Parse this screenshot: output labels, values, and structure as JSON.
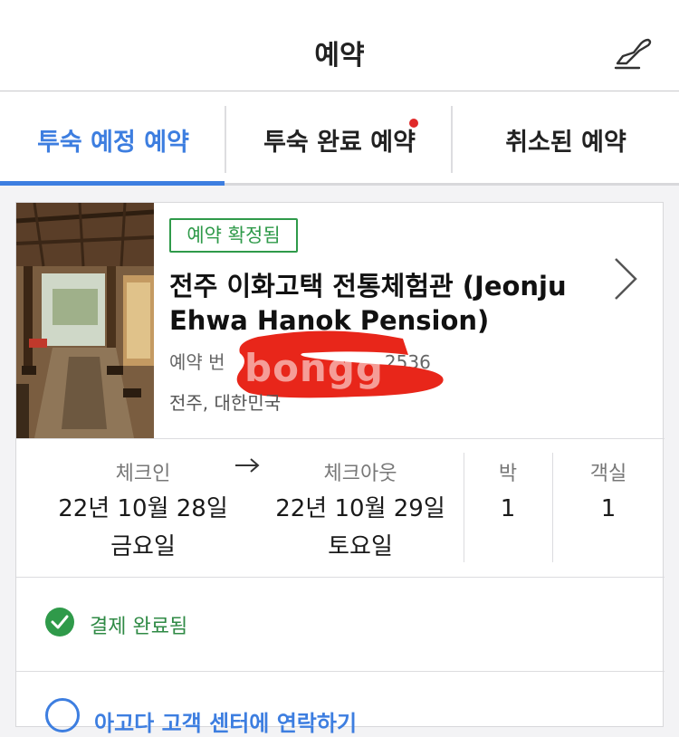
{
  "header": {
    "title": "예약",
    "plane_icon": "plane-icon"
  },
  "tabs": [
    {
      "label": "투숙 예정 예약",
      "active": true
    },
    {
      "label": "투숙 완료 예약",
      "has_badge": true
    },
    {
      "label": "취소된 예약"
    }
  ],
  "booking": {
    "status": "예약 확정됨",
    "hotel_name": "전주 이화고택 전통체험관 (Jeonju Ehwa Hanok Pension)",
    "booking_number_label": "예약 번",
    "booking_number_partial": "2536",
    "watermark": "bongg",
    "location": "전주, 대한민국",
    "checkin_label": "체크인",
    "checkin_date": "22년 10월 28일",
    "checkin_day": "금요일",
    "checkout_label": "체크아웃",
    "checkout_date": "22년 10월 29일",
    "checkout_day": "토요일",
    "nights_label": "박",
    "nights": "1",
    "rooms_label": "객실",
    "rooms": "1",
    "payment_status": "결제 완료됨",
    "contact_label": "아고다 고객 센터에 연락하기"
  },
  "colors": {
    "accent": "#3d7ee0",
    "success": "#2f9a4a",
    "badge": "#e02a2a",
    "redaction": "#e8261a"
  }
}
